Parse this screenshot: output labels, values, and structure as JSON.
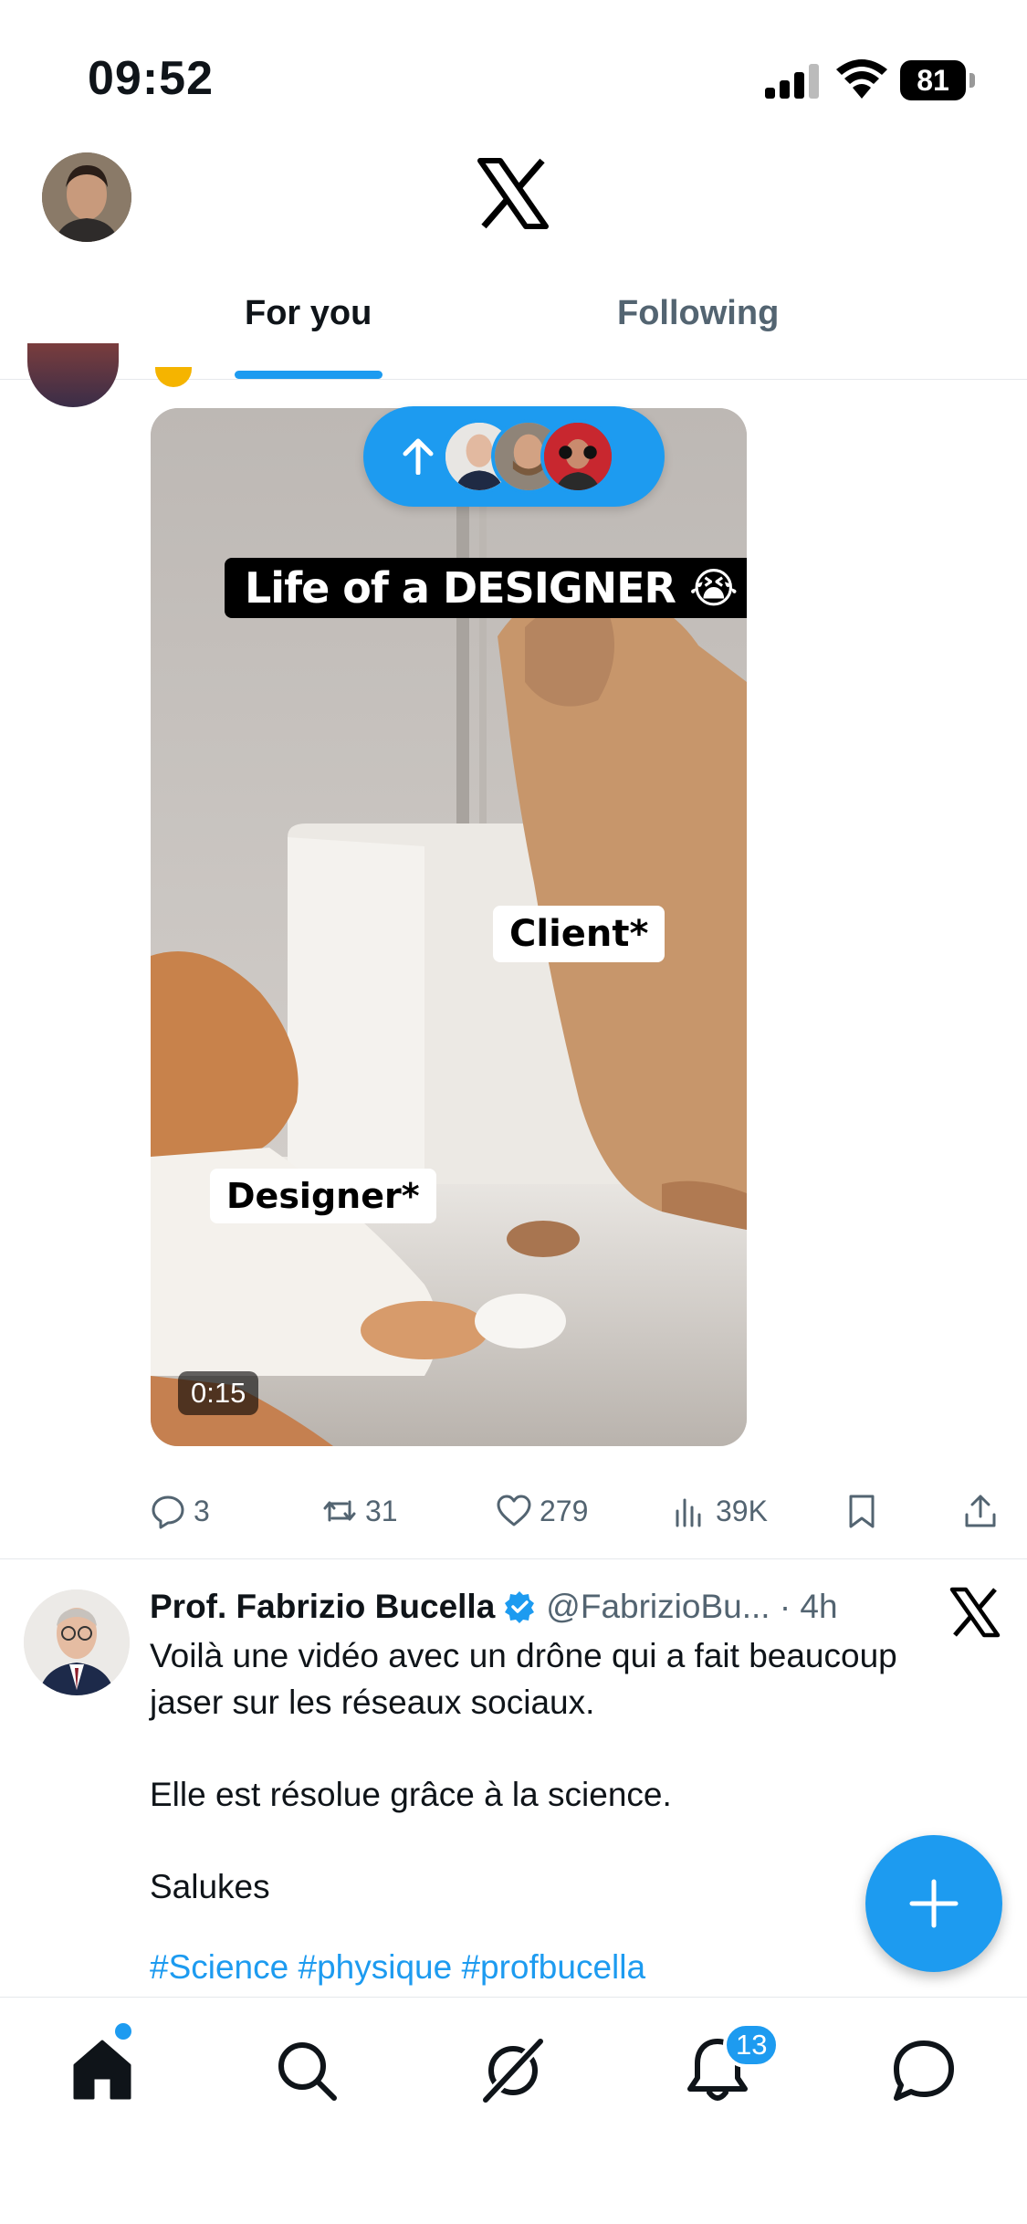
{
  "status_bar": {
    "time": "09:52",
    "battery": "81"
  },
  "header": {
    "logo_icon": "x-logo-icon",
    "avatar_icon": "user-avatar"
  },
  "tabs": [
    {
      "label": "For you",
      "active": true
    },
    {
      "label": "Following",
      "active": false
    }
  ],
  "new_posts_pill": {
    "icon": "arrow-up-icon",
    "avatars": 3
  },
  "video": {
    "caption_title": "Life of a DESIGNER 😭",
    "label_client": "Client*",
    "label_designer": "Designer*",
    "duration": "0:15"
  },
  "actions": {
    "replies": "3",
    "reposts": "31",
    "likes": "279",
    "views": "39K"
  },
  "tweet": {
    "author_name": "Prof. Fabrizio Bucella",
    "handle_time": "@FabrizioBu... · 4h",
    "paragraphs": [
      "Voilà une vidéo avec un drône qui a fait beaucoup jaser sur les réseaux sociaux.",
      "Elle est résolue grâce à la science.",
      "Salukes"
    ],
    "hashtags": "#Science #physique #profbucella"
  },
  "bottom_nav": {
    "notifications_badge": "13"
  },
  "colors": {
    "accent": "#1d9bf0",
    "text": "#0f1419",
    "secondary": "#536471"
  }
}
